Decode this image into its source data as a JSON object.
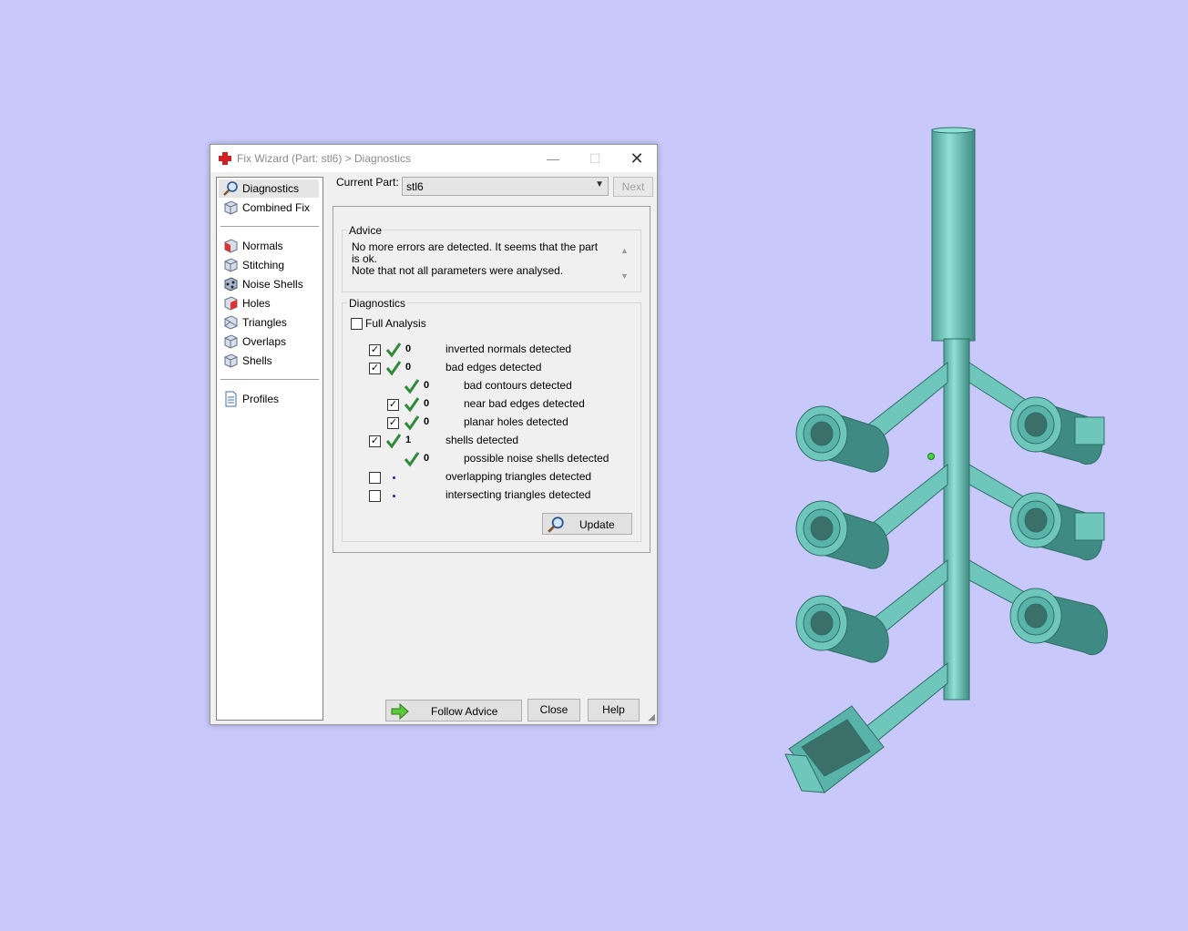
{
  "window": {
    "title": "Fix Wizard (Part: stl6) > Diagnostics",
    "minimize_glyph": "—",
    "maximize_glyph": "☐",
    "close_glyph": "✕"
  },
  "sidebar": {
    "items": [
      {
        "label": "Diagnostics",
        "icon": "magnifier-icon"
      },
      {
        "label": "Combined Fix",
        "icon": "cube-icon"
      },
      {
        "label": "Normals",
        "icon": "cube-normals-icon"
      },
      {
        "label": "Stitching",
        "icon": "cube-stitching-icon"
      },
      {
        "label": "Noise Shells",
        "icon": "noise-shells-icon"
      },
      {
        "label": "Holes",
        "icon": "cube-holes-icon"
      },
      {
        "label": "Triangles",
        "icon": "cube-triangles-icon"
      },
      {
        "label": "Overlaps",
        "icon": "cube-overlaps-icon"
      },
      {
        "label": "Shells",
        "icon": "cube-shells-icon"
      },
      {
        "label": "Profiles",
        "icon": "document-icon"
      }
    ]
  },
  "current_part": {
    "label": "Current Part:",
    "value": "stl6",
    "next_label": "Next"
  },
  "advice": {
    "title": "Advice",
    "line1": "No more errors are detected. It seems that the part is ok.",
    "line2": "Note that not all parameters were analysed."
  },
  "diagnostics": {
    "title": "Diagnostics",
    "full_analysis_label": "Full Analysis",
    "full_analysis_checked": false,
    "rows": [
      {
        "checked": true,
        "status": "ok",
        "count": "0",
        "label": "inverted normals detected"
      },
      {
        "checked": true,
        "status": "ok",
        "count": "0",
        "label": "bad edges detected"
      },
      {
        "checked": null,
        "status": "ok",
        "count": "0",
        "label": "bad contours detected"
      },
      {
        "checked": true,
        "status": "ok",
        "count": "0",
        "label": "near bad edges detected"
      },
      {
        "checked": true,
        "status": "ok",
        "count": "0",
        "label": "planar holes detected"
      },
      {
        "checked": true,
        "status": "ok",
        "count": "1",
        "label": "shells detected"
      },
      {
        "checked": null,
        "status": "ok",
        "count": "0",
        "label": "possible noise shells detected"
      },
      {
        "checked": false,
        "status": "pending",
        "count": "",
        "label": "overlapping triangles detected"
      },
      {
        "checked": false,
        "status": "pending",
        "count": "",
        "label": "intersecting triangles detected"
      }
    ],
    "update_label": "Update"
  },
  "footer": {
    "follow_advice_label": "Follow Advice",
    "close_label": "Close",
    "help_label": "Help"
  },
  "colors": {
    "background": "#c8c8fa",
    "model": "#6fc7bc",
    "check_green": "#2e8b3a",
    "dot_blue": "#2020c0"
  }
}
